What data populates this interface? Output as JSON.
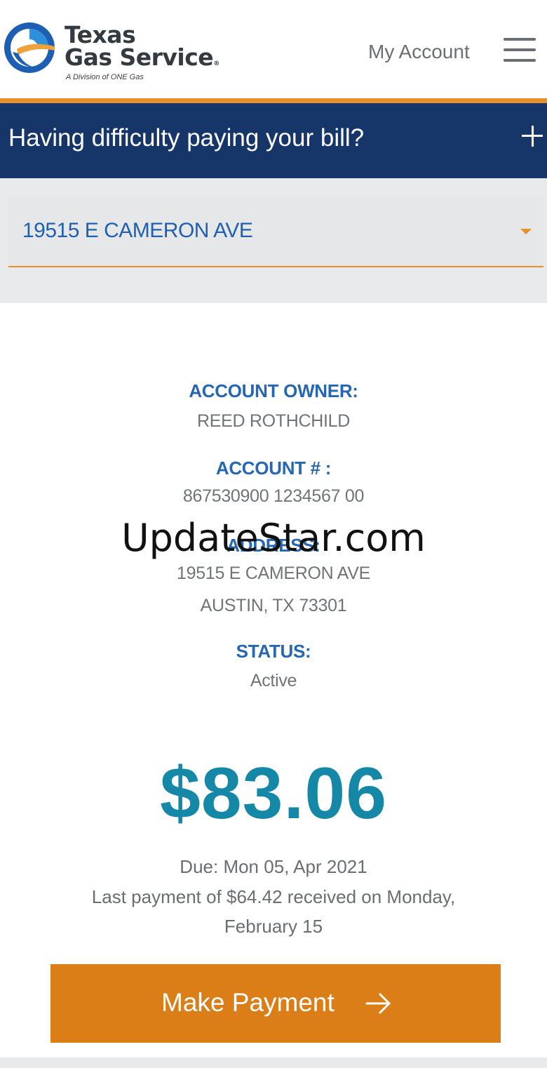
{
  "header": {
    "brand_line1": "Texas",
    "brand_line2": "Gas Service",
    "brand_reg": "®",
    "tagline": "A Division of ONE Gas",
    "my_account": "My Account",
    "menu_icon": "hamburger-menu-icon"
  },
  "banner": {
    "text": "Having difficulty paying your bill?",
    "icon": "plus-icon"
  },
  "address_select": {
    "value": "19515 E CAMERON AVE",
    "icon": "caret-down-icon"
  },
  "account": {
    "owner_label": "ACCOUNT OWNER:",
    "owner_value": "REED ROTHCHILD",
    "number_label": "ACCOUNT # :",
    "number_value": "867530900  1234567 00",
    "address_label": "ADDRESS:",
    "address_line1": "19515 E CAMERON AVE",
    "address_line2": "AUSTIN, TX 73301",
    "status_label": "STATUS:",
    "status_value": "Active"
  },
  "billing": {
    "amount": "$83.06",
    "due": "Due: Mon 05, Apr 2021",
    "last_payment_line1": "Last payment of $64.42 received on Monday,",
    "last_payment_line2": "February 15"
  },
  "actions": {
    "make_payment": "Make Payment",
    "arrow_icon": "arrow-right-icon"
  },
  "watermark": "UpdateStar.com",
  "colors": {
    "navy": "#16366a",
    "orange": "#e8902a",
    "button_orange": "#db7e17",
    "label_blue": "#2567b3",
    "amount_teal": "#1588a8"
  }
}
